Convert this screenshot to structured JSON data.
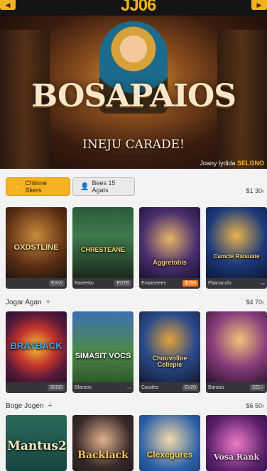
{
  "header": {
    "logo": "JJ06",
    "nav_left_icon": "chevron-left-icon",
    "nav_right_icon": "chevron-right-icon"
  },
  "hero": {
    "title": "BOSAPAIOS",
    "subtitle": "INEJU CARADE!",
    "credit": "Joany lydida",
    "credit_brand": "SELGNO"
  },
  "tabs": [
    {
      "label": "Chlinne Skers",
      "icon": "hand-icon",
      "selected": true
    },
    {
      "label": "Bees 15 Agats",
      "icon": "user-icon",
      "selected": false
    }
  ],
  "rows": [
    {
      "title": "",
      "total": "$1 30‹",
      "cards": [
        {
          "label": "OXDSTLINE",
          "caption": "",
          "value": "EXVI"
        },
        {
          "label": "CHRESTEANE",
          "caption": "Rareetto",
          "value": "E0TE"
        },
        {
          "label": "Aggretobis",
          "caption": "Evaaneees",
          "value": "$755"
        },
        {
          "label": "Cumcle Ratsuate",
          "caption": "Fbanacolo",
          "value": ""
        }
      ]
    },
    {
      "title": "Jogar Agan",
      "total": "$4 70‹",
      "cards": [
        {
          "label": "BRAYBACK",
          "caption": "",
          "value": "50I30"
        },
        {
          "label": "SIMASIT VOCS",
          "caption": "Blaroos",
          "value": ""
        },
        {
          "label": "Chouvolloe Cellepie",
          "caption": "Caudes",
          "value": "Ev20"
        },
        {
          "label": "",
          "caption": "Baraou",
          "value": "SELI"
        }
      ]
    },
    {
      "title": "Boge Jogen",
      "total": "$6 50‹",
      "cards": [
        {
          "label": "Mantus2",
          "caption": "",
          "value": ""
        },
        {
          "label": "Backlack",
          "caption": "",
          "value": ""
        },
        {
          "label": "Clexegures",
          "caption": "",
          "value": ""
        },
        {
          "label": "Vosa Rank",
          "caption": "",
          "value": ""
        }
      ]
    }
  ],
  "colors": {
    "accent": "#f5b323",
    "orange_badge": "#f07a22",
    "purple_badge": "#7b4bd8"
  }
}
